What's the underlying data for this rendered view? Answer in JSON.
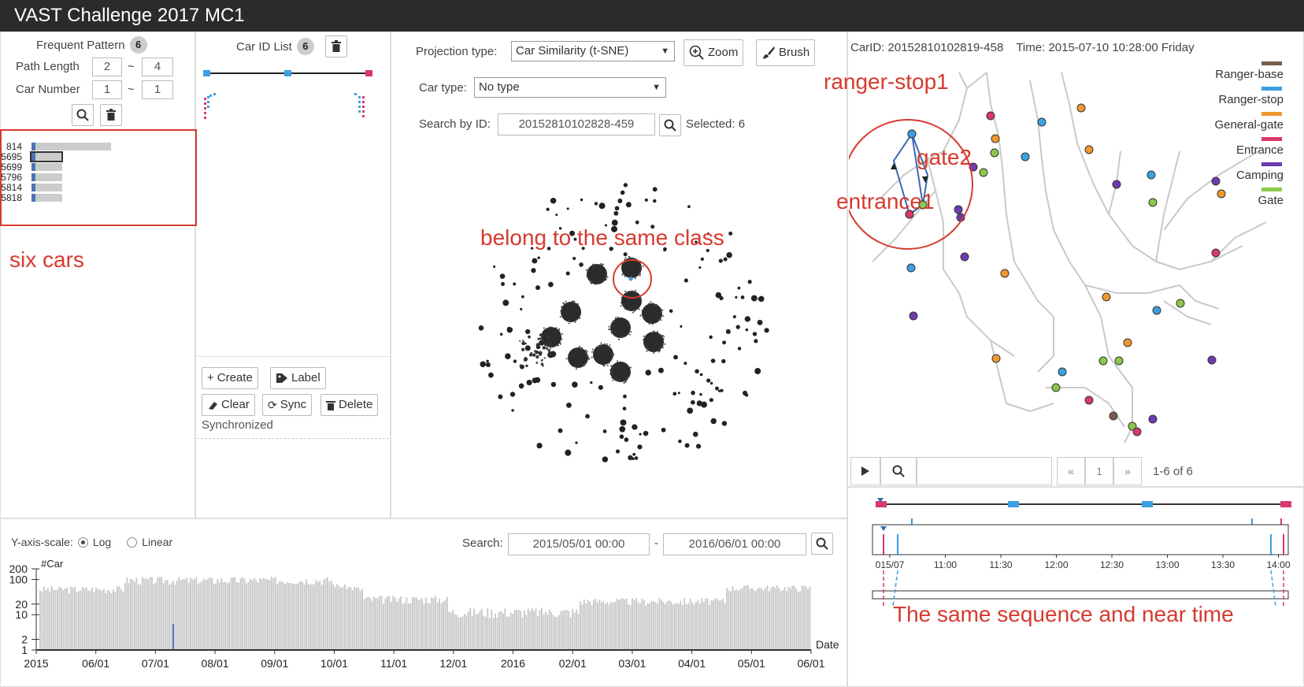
{
  "app": {
    "title": "VAST Challenge 2017 MC1"
  },
  "frequent_pattern": {
    "title": "Frequent Pattern",
    "count": "6",
    "path_length_label": "Path Length",
    "path_length_min": "2",
    "path_length_max": "4",
    "car_number_label": "Car Number",
    "car_number_min": "1",
    "car_number_max": "1",
    "range_sep": "~",
    "rows": [
      {
        "id": "814",
        "value": 0.92
      },
      {
        "id": "5695",
        "value": 0.35
      },
      {
        "id": "5699",
        "value": 0.35
      },
      {
        "id": "5796",
        "value": 0.35
      },
      {
        "id": "5814",
        "value": 0.35
      },
      {
        "id": "5818",
        "value": 0.35
      }
    ]
  },
  "car_list": {
    "title": "Car ID List",
    "count": "6",
    "create_label": "Create",
    "label_label": "Label",
    "clear_label": "Clear",
    "sync_label": "Sync",
    "delete_label": "Delete",
    "status": "Synchronized"
  },
  "projection": {
    "projection_type_label": "Projection type:",
    "projection_type_value": "Car Similarity (t-SNE)",
    "zoom_label": "Zoom",
    "brush_label": "Brush",
    "car_type_label": "Car type:",
    "car_type_value": "No type",
    "search_label": "Search by ID:",
    "search_value": "20152810102828-459",
    "selected_text": "Selected: 6"
  },
  "map": {
    "info_car": "CarID: 20152810102819-458",
    "info_time": "Time: 2015-07-10 10:28:00 Friday",
    "legend": [
      {
        "name": "Ranger-base",
        "color": "#7a5c4f"
      },
      {
        "name": "Ranger-stop",
        "color": "#3ca0e0"
      },
      {
        "name": "General-gate",
        "color": "#f0982e"
      },
      {
        "name": "Entrance",
        "color": "#d83a6a"
      },
      {
        "name": "Camping",
        "color": "#6c3bb0"
      },
      {
        "name": "Gate",
        "color": "#8cc84b"
      }
    ],
    "pager": {
      "prev": "«",
      "page": "1",
      "next": "»",
      "summary": "1-6 of 6"
    }
  },
  "timeline": {
    "ticks": [
      "015/07",
      "11:00",
      "11:30",
      "12:00",
      "12:30",
      "13:00",
      "13:30",
      "14:00"
    ]
  },
  "histogram": {
    "yscale_label": "Y-axis-scale:",
    "log_label": "Log",
    "linear_label": "Linear",
    "search_label": "Search:",
    "date_from": "2015/05/01 00:00",
    "date_sep": "-",
    "date_to": "2016/06/01 00:00",
    "y_title": "#Car",
    "x_title": "Date",
    "y_ticks": [
      "200",
      "100",
      "20",
      "10",
      "2",
      "1"
    ],
    "x_ticks": [
      "2015",
      "06/01",
      "07/01",
      "08/01",
      "09/01",
      "10/01",
      "11/01",
      "12/01",
      "2016",
      "02/01",
      "03/01",
      "04/01",
      "05/01",
      "06/01"
    ]
  },
  "annotations": {
    "six_cars": "six cars",
    "same_class": "belong to the same class",
    "ranger_stop1": "ranger-stop1",
    "gate2": "gate2",
    "entrance1": "entrance1",
    "same_sequence": "The same sequence and near time"
  },
  "colors": {
    "accent_red": "#d63a2f",
    "ranger_stop": "#3ca0e0",
    "entrance": "#d83a6a",
    "bar_gray": "#c8c8c8"
  }
}
